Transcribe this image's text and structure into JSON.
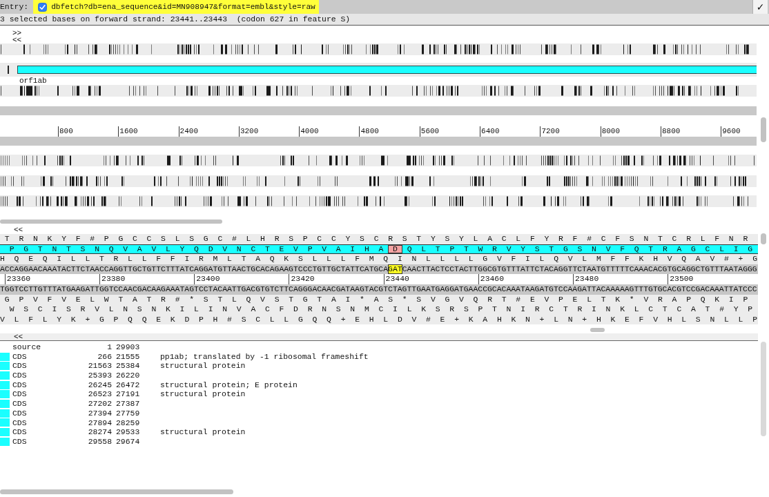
{
  "entry_bar": {
    "label": "Entry:",
    "entries": [
      {
        "name": "dbfetch?db=ena_sequence&id=MN908947&format=embl&style=raw",
        "checked": true,
        "active": true
      }
    ],
    "confirm_button": "✓"
  },
  "status_line": "3 selected bases on forward strand: 23441..23443  (codon 627 in feature S)",
  "overview": {
    "markers": [
      ">>",
      "<<"
    ],
    "tracks": [
      {
        "kind": "stop_codons"
      },
      {
        "kind": "features",
        "features": [
          {
            "label": "orf1ab"
          }
        ]
      },
      {
        "kind": "stop_codons"
      },
      {
        "kind": "strand"
      },
      {
        "kind": "scale",
        "ticks": [
          "800",
          "1600",
          "2400",
          "3200",
          "4000",
          "4800",
          "5600",
          "6400",
          "7200",
          "8000",
          "8800",
          "9600"
        ]
      },
      {
        "kind": "strand"
      },
      {
        "kind": "stop_codons"
      },
      {
        "kind": "stop_codons"
      },
      {
        "kind": "stop_codons"
      }
    ]
  },
  "sequence_view": {
    "marker": "<<",
    "rows": [
      {
        "kind": "frame",
        "feature": false,
        "segments": [
          {
            "text": "T R N K Y F # P G C C S L S G C # L H R S P C C Y S C R S T Y S Y L A C L F Y R F # C F S N T C R L F N R",
            "selected": false
          }
        ]
      },
      {
        "kind": "frame",
        "feature": true,
        "segments": [
          {
            "text": "P G T N T S N Q V A V L Y Q D V N C T E V P V A I H A",
            "selected": false
          },
          {
            "text": "D",
            "selected": true
          },
          {
            "text": "Q L T P T W R V Y S T G S N V F Q T R A G C L I G",
            "selected": false
          }
        ]
      },
      {
        "kind": "frame",
        "feature": false,
        "segments": [
          {
            "text": "H Q E Q I L L T R L L F F I R M L T A Q K S L L L F M Q I N L L L L G V F I L Q V L M F F K H V Q A V # + G",
            "selected": false
          }
        ]
      },
      {
        "kind": "bases",
        "segments": [
          {
            "text": "ACCAGGAACAAATACTTCTAACCAGGTTGCTGTTCTTTATCAGGATGTTAACTGCACAGAAGTCCCTGTTGCTATTCATGCA",
            "selected": false
          },
          {
            "text": "GAT",
            "selected": true
          },
          {
            "text": "CAACTTACTCCTACTTGGCGTGTTTATTCTACAGGTTCTAATGTTTTTCAAACACGTGCAGGCTGTTTAATAGGG",
            "selected": false
          }
        ]
      },
      {
        "kind": "scale",
        "ticks": [
          "23360",
          "23380",
          "23400",
          "23420",
          "23440",
          "23460",
          "23480",
          "23500"
        ]
      },
      {
        "kind": "bases",
        "segments": [
          {
            "text": "TGGTCCTTGTTTATGAAGATTGGTCCAACGACAAGAAATAGTCCTACAATTGACGTGTCTTCAGGGACAACGATAAGTACGTCTAGTTGAATGAGGATGAACCGCACAAATAAGATGTCCAAGATTACAAAAAGTTTGTGCACGTCCGACAAATTATCCC",
            "selected": false
          }
        ]
      },
      {
        "kind": "frame",
        "feature": false,
        "segments": [
          {
            "text": "G P V F V E L W T A T R # * S T L Q V S T G T A I * A S * S V G V Q R T # E V P E L T K * V R A P Q K I P",
            "selected": false
          }
        ]
      },
      {
        "kind": "frame",
        "feature": false,
        "segments": [
          {
            "text": "W S C I S R V L N S N K I L I N V A C F D R N S N M C I L K S R S P T N I R C T R I N K L C T C A T # Y P",
            "selected": false
          }
        ]
      },
      {
        "kind": "frame",
        "feature": false,
        "segments": [
          {
            "text": "V L F L Y K + G P Q Q E K D P H # S C L L G Q Q + E H L D V # E + K A H K N + L N + H K E F V H L S N L L P",
            "selected": false
          }
        ]
      }
    ]
  },
  "feature_list": {
    "marker": "<<",
    "features": [
      {
        "key": "source",
        "start": "1",
        "end": "29903"
      },
      {
        "key": "CDS",
        "color": "#1affff",
        "start": "266",
        "end": "21555",
        "note": "pp1ab; translated by -1 ribosomal frameshift"
      },
      {
        "key": "CDS",
        "color": "#1affff",
        "start": "21563",
        "end": "25384",
        "note": "structural protein"
      },
      {
        "key": "CDS",
        "color": "#1affff",
        "start": "25393",
        "end": "26220"
      },
      {
        "key": "CDS",
        "color": "#1affff",
        "start": "26245",
        "end": "26472",
        "note": "structural protein; E protein"
      },
      {
        "key": "CDS",
        "color": "#1affff",
        "start": "26523",
        "end": "27191",
        "note": "structural protein"
      },
      {
        "key": "CDS",
        "color": "#1affff",
        "start": "27202",
        "end": "27387"
      },
      {
        "key": "CDS",
        "color": "#1affff",
        "start": "27394",
        "end": "27759"
      },
      {
        "key": "CDS",
        "color": "#1affff",
        "start": "27894",
        "end": "28259"
      },
      {
        "key": "CDS",
        "color": "#1affff",
        "start": "28274",
        "end": "29533",
        "note": "structural protein"
      },
      {
        "key": "CDS",
        "color": "#1affff",
        "start": "29558",
        "end": "29674"
      }
    ]
  }
}
